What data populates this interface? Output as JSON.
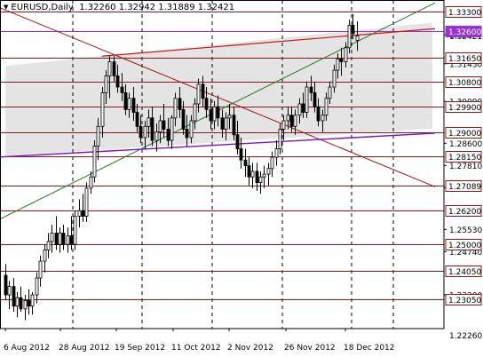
{
  "header": {
    "symbol_timeframe": "EURUSD,Daily",
    "ohlc": "1.32260 1.32942 1.31889 1.32421"
  },
  "chart_data": {
    "type": "candlestick",
    "symbol": "EURUSD",
    "timeframe": "Daily",
    "title": "EURUSD,Daily",
    "last_bar": {
      "open": 1.3226,
      "high": 1.32942,
      "low": 1.31889,
      "close": 1.32421
    },
    "ylim": [
      1.22,
      1.337
    ],
    "price_axis_labels": [
      1.232,
      1.2474,
      1.2553,
      1.2702,
      1.2781,
      1.286,
      1.3009,
      1.3143,
      1.3247
    ],
    "price_axis_labels_text": [
      "1.23200",
      "1.24740",
      "1.25530",
      "1.27020",
      "1.27810",
      "1.28600",
      "1.30090",
      "1.31430",
      "1.32470"
    ],
    "extra_tick_labels": [
      "1.22260",
      "1.32421"
    ],
    "x_tick_labels": [
      "6 Aug 2012",
      "28 Aug 2012",
      "19 Sep 2012",
      "11 Oct 2012",
      "2 Nov 2012",
      "26 Nov 2012",
      "18 Dec 2012"
    ],
    "current_price": 1.32421,
    "current_price_label": "1.32421",
    "levels": [
      {
        "price": 1.333,
        "label": "1.33300",
        "highlight": false
      },
      {
        "price": 1.326,
        "label": "1.32600",
        "highlight": true
      },
      {
        "price": 1.3165,
        "label": "1.31650",
        "highlight": false
      },
      {
        "price": 1.308,
        "label": "1.30800",
        "highlight": false
      },
      {
        "price": 1.299,
        "label": "1.29900",
        "highlight": false
      },
      {
        "price": 1.29,
        "label": "1.29000",
        "highlight": false
      },
      {
        "price": 1.2815,
        "label": "1.28150",
        "highlight": false
      },
      {
        "price": 1.27089,
        "label": "1.27089",
        "highlight": false
      },
      {
        "price": 1.262,
        "label": "1.26200",
        "highlight": false
      },
      {
        "price": 1.25,
        "label": "1.25000",
        "highlight": false
      },
      {
        "price": 1.2405,
        "label": "1.24050",
        "highlight": false
      },
      {
        "price": 1.2305,
        "label": "1.23050",
        "highlight": false
      }
    ],
    "candles": [
      [
        1.239,
        1.243,
        1.23,
        1.232
      ],
      [
        1.232,
        1.237,
        1.227,
        1.235
      ],
      [
        1.235,
        1.238,
        1.226,
        1.228
      ],
      [
        1.228,
        1.233,
        1.224,
        1.231
      ],
      [
        1.231,
        1.235,
        1.226,
        1.227
      ],
      [
        1.227,
        1.232,
        1.223,
        1.23
      ],
      [
        1.23,
        1.234,
        1.225,
        1.228
      ],
      [
        1.228,
        1.233,
        1.225,
        1.232
      ],
      [
        1.232,
        1.24,
        1.229,
        1.238
      ],
      [
        1.238,
        1.246,
        1.235,
        1.244
      ],
      [
        1.244,
        1.25,
        1.24,
        1.248
      ],
      [
        1.248,
        1.254,
        1.245,
        1.251
      ],
      [
        1.251,
        1.257,
        1.247,
        1.254
      ],
      [
        1.254,
        1.26,
        1.248,
        1.25
      ],
      [
        1.25,
        1.256,
        1.247,
        1.254
      ],
      [
        1.254,
        1.257,
        1.248,
        1.25
      ],
      [
        1.25,
        1.256,
        1.247,
        1.253
      ],
      [
        1.253,
        1.26,
        1.248,
        1.25
      ],
      [
        1.25,
        1.262,
        1.248,
        1.26
      ],
      [
        1.26,
        1.266,
        1.256,
        1.262
      ],
      [
        1.262,
        1.268,
        1.258,
        1.26
      ],
      [
        1.26,
        1.272,
        1.258,
        1.27
      ],
      [
        1.27,
        1.276,
        1.268,
        1.274
      ],
      [
        1.274,
        1.287,
        1.272,
        1.285
      ],
      [
        1.285,
        1.295,
        1.28,
        1.292
      ],
      [
        1.292,
        1.306,
        1.288,
        1.304
      ],
      [
        1.304,
        1.312,
        1.3,
        1.31
      ],
      [
        1.31,
        1.317,
        1.302,
        1.315
      ],
      [
        1.315,
        1.317,
        1.308,
        1.31
      ],
      [
        1.31,
        1.314,
        1.304,
        1.306
      ],
      [
        1.306,
        1.311,
        1.301,
        1.304
      ],
      [
        1.304,
        1.307,
        1.296,
        1.298
      ],
      [
        1.298,
        1.304,
        1.295,
        1.302
      ],
      [
        1.302,
        1.306,
        1.294,
        1.297
      ],
      [
        1.297,
        1.3,
        1.29,
        1.292
      ],
      [
        1.292,
        1.296,
        1.286,
        1.288
      ],
      [
        1.288,
        1.294,
        1.284,
        1.292
      ],
      [
        1.292,
        1.298,
        1.288,
        1.295
      ],
      [
        1.295,
        1.299,
        1.285,
        1.287
      ],
      [
        1.287,
        1.293,
        1.283,
        1.29
      ],
      [
        1.29,
        1.296,
        1.286,
        1.294
      ],
      [
        1.294,
        1.3,
        1.288,
        1.291
      ],
      [
        1.291,
        1.295,
        1.285,
        1.287
      ],
      [
        1.287,
        1.296,
        1.284,
        1.295
      ],
      [
        1.295,
        1.304,
        1.292,
        1.302
      ],
      [
        1.302,
        1.306,
        1.295,
        1.298
      ],
      [
        1.298,
        1.301,
        1.289,
        1.291
      ],
      [
        1.291,
        1.296,
        1.285,
        1.288
      ],
      [
        1.288,
        1.296,
        1.286,
        1.294
      ],
      [
        1.294,
        1.302,
        1.291,
        1.3
      ],
      [
        1.3,
        1.309,
        1.297,
        1.307
      ],
      [
        1.307,
        1.31,
        1.299,
        1.302
      ],
      [
        1.302,
        1.306,
        1.295,
        1.298
      ],
      [
        1.298,
        1.302,
        1.291,
        1.294
      ],
      [
        1.294,
        1.301,
        1.291,
        1.299
      ],
      [
        1.299,
        1.303,
        1.292,
        1.295
      ],
      [
        1.295,
        1.298,
        1.288,
        1.291
      ],
      [
        1.291,
        1.297,
        1.287,
        1.295
      ],
      [
        1.295,
        1.3,
        1.291,
        1.296
      ],
      [
        1.296,
        1.299,
        1.287,
        1.289
      ],
      [
        1.289,
        1.294,
        1.282,
        1.284
      ],
      [
        1.284,
        1.288,
        1.277,
        1.28
      ],
      [
        1.28,
        1.284,
        1.274,
        1.278
      ],
      [
        1.278,
        1.281,
        1.271,
        1.274
      ],
      [
        1.274,
        1.279,
        1.27,
        1.276
      ],
      [
        1.276,
        1.279,
        1.269,
        1.272
      ],
      [
        1.272,
        1.276,
        1.268,
        1.274
      ],
      [
        1.274,
        1.278,
        1.27,
        1.275
      ],
      [
        1.275,
        1.279,
        1.271,
        1.277
      ],
      [
        1.277,
        1.283,
        1.274,
        1.281
      ],
      [
        1.281,
        1.287,
        1.278,
        1.284
      ],
      [
        1.284,
        1.293,
        1.282,
        1.291
      ],
      [
        1.291,
        1.296,
        1.287,
        1.294
      ],
      [
        1.294,
        1.299,
        1.291,
        1.296
      ],
      [
        1.296,
        1.299,
        1.29,
        1.292
      ],
      [
        1.292,
        1.298,
        1.289,
        1.296
      ],
      [
        1.296,
        1.302,
        1.293,
        1.3
      ],
      [
        1.3,
        1.304,
        1.295,
        1.297
      ],
      [
        1.297,
        1.308,
        1.295,
        1.306
      ],
      [
        1.306,
        1.31,
        1.301,
        1.304
      ],
      [
        1.304,
        1.308,
        1.297,
        1.299
      ],
      [
        1.299,
        1.302,
        1.292,
        1.294
      ],
      [
        1.294,
        1.298,
        1.29,
        1.296
      ],
      [
        1.296,
        1.304,
        1.294,
        1.302
      ],
      [
        1.302,
        1.308,
        1.3,
        1.306
      ],
      [
        1.306,
        1.314,
        1.304,
        1.312
      ],
      [
        1.312,
        1.318,
        1.309,
        1.316
      ],
      [
        1.316,
        1.32,
        1.31,
        1.315
      ],
      [
        1.315,
        1.322,
        1.313,
        1.32
      ],
      [
        1.32,
        1.33,
        1.318,
        1.328
      ],
      [
        1.328,
        1.332,
        1.323,
        1.325
      ],
      [
        1.3226,
        1.3294,
        1.3189,
        1.3242
      ]
    ]
  }
}
